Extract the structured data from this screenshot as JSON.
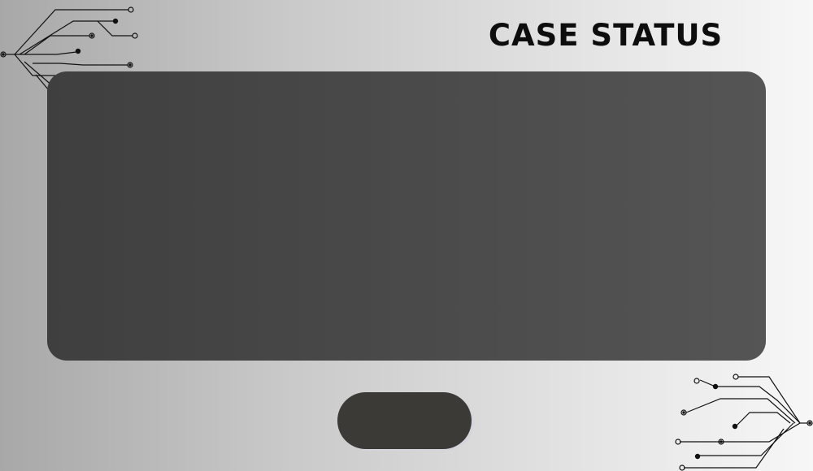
{
  "page": {
    "title": "CASE STATUS",
    "background_colors": [
      "#a8a8a8",
      "#f7f7f7"
    ]
  },
  "status_panel": {
    "color": "#4a4a4a",
    "content": ""
  },
  "action_button": {
    "label": "",
    "color": "#3b3a37"
  },
  "decorations": {
    "circuit_icon_name": "circuit-lines-icon",
    "circuit_color": "#111111"
  }
}
